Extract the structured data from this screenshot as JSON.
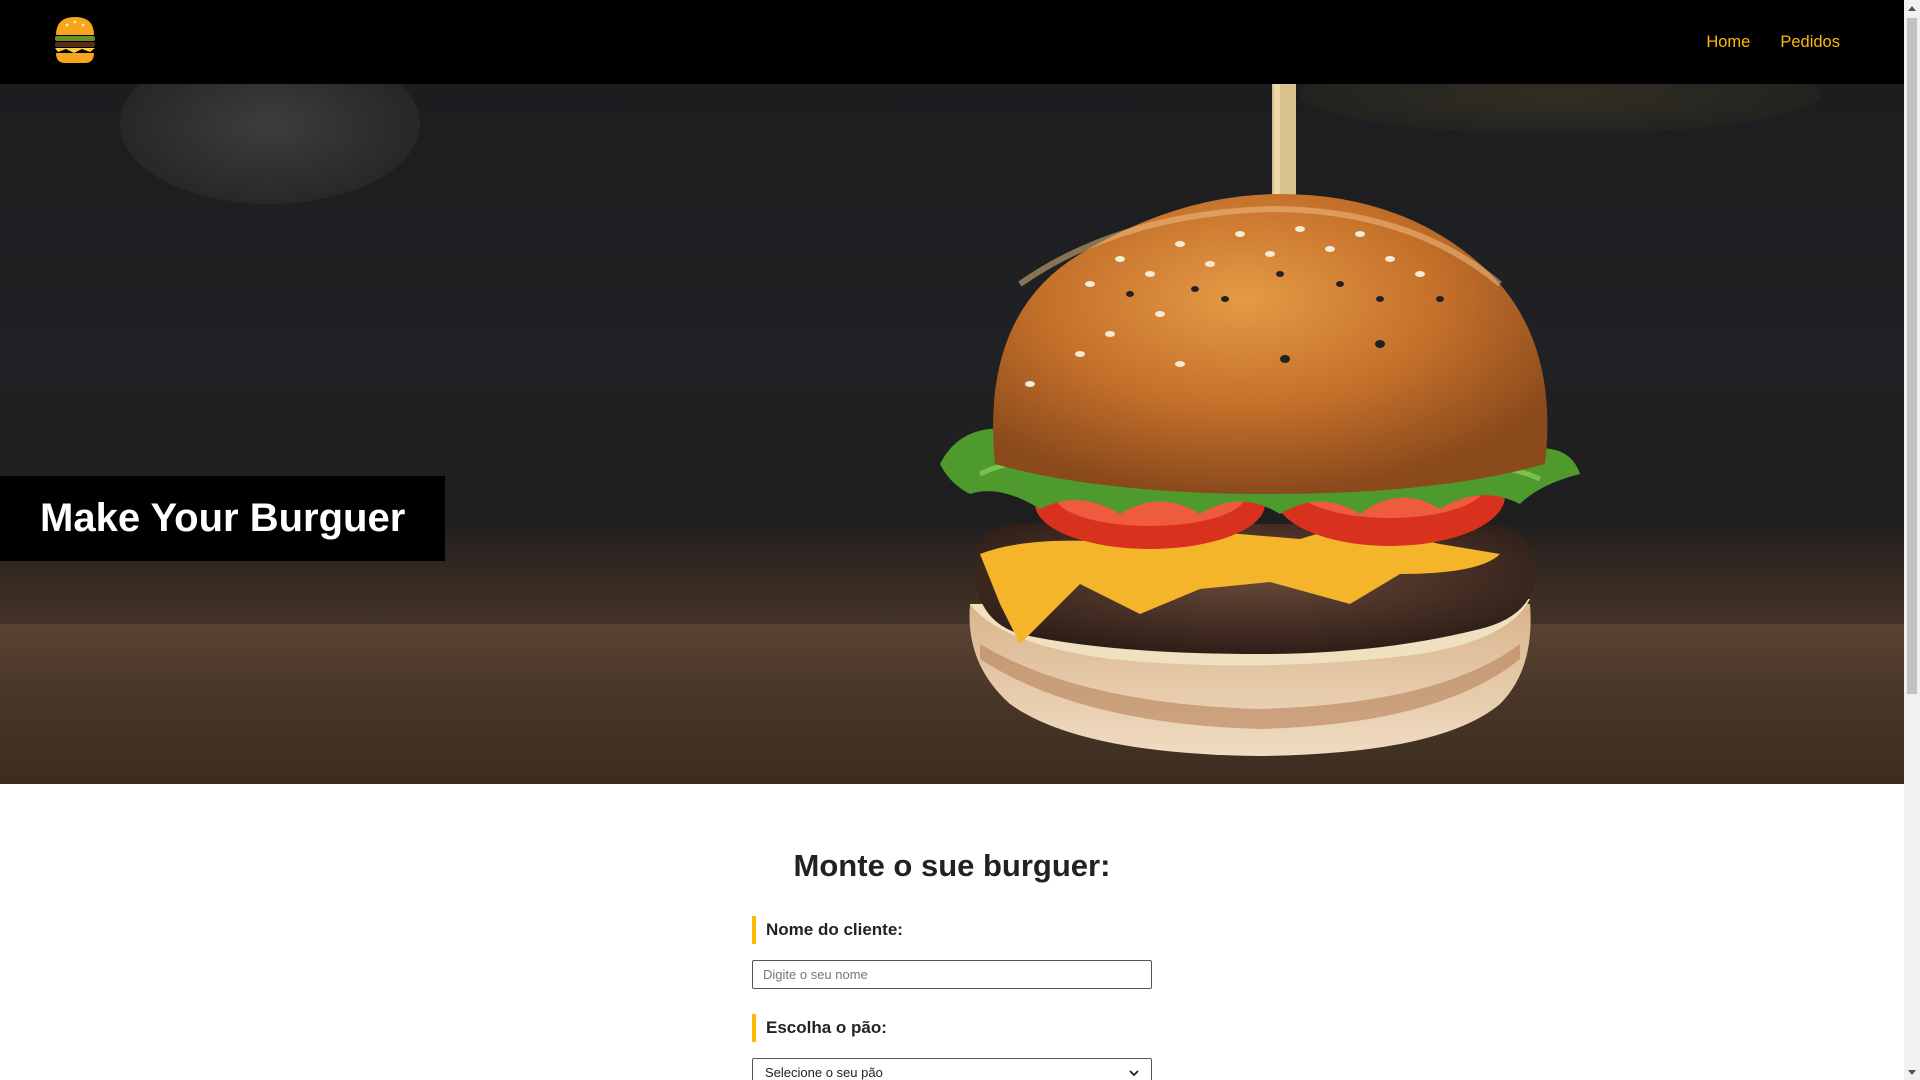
{
  "nav": {
    "logo_icon": "burger-logo-icon",
    "links": [
      {
        "label": "Home"
      },
      {
        "label": "Pedidos"
      }
    ]
  },
  "hero": {
    "title": "Make Your Burguer",
    "image": "burger-photo"
  },
  "form": {
    "title": "Monte o sue burguer:",
    "name_label": "Nome do cliente:",
    "name_placeholder": "Digite o seu nome",
    "name_value": "",
    "bread_label": "Escolha o pão:",
    "bread_selected": "Selecione o seu pão"
  },
  "colors": {
    "accent": "#fcba03",
    "navbar": "#000000"
  }
}
